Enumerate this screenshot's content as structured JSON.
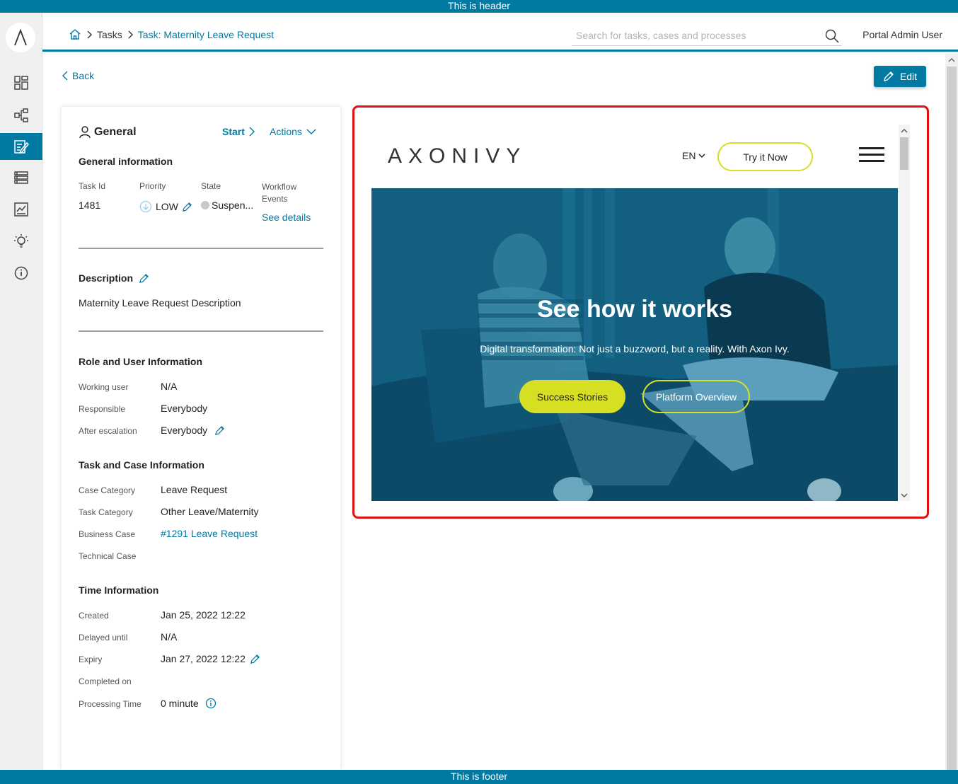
{
  "app": {
    "header_banner": "This is header",
    "footer_banner": "This is footer"
  },
  "header": {
    "breadcrumb": {
      "tasks": "Tasks",
      "current": "Task: Maternity Leave Request"
    },
    "search_placeholder": "Search for tasks, cases and processes",
    "user": "Portal Admin User"
  },
  "sidebar": {
    "items": [
      "dashboard-icon",
      "processes-icon",
      "tasks-icon",
      "cases-icon",
      "statistics-icon",
      "ideas-icon",
      "info-icon"
    ],
    "active": "tasks-icon"
  },
  "toolbar": {
    "back": "Back",
    "edit": "Edit"
  },
  "general": {
    "title": "General",
    "start": "Start",
    "actions": "Actions",
    "info_heading": "General information",
    "task_id_label": "Task Id",
    "task_id": "1481",
    "priority_label": "Priority",
    "priority": "LOW",
    "state_label": "State",
    "state": "Suspen...",
    "workflow_label": "Workflow Events",
    "see_details": "See details",
    "description_heading": "Description",
    "description": "Maternity Leave Request Description",
    "role_heading": "Role and User Information",
    "working_user_label": "Working user",
    "working_user": "N/A",
    "responsible_label": "Responsible",
    "responsible": "Everybody",
    "after_escalation_label": "After escalation",
    "after_escalation": "Everybody",
    "task_case_heading": "Task and Case Information",
    "case_category_label": "Case Category",
    "case_category": "Leave Request",
    "task_category_label": "Task Category",
    "task_category": "Other Leave/Maternity",
    "business_case_label": "Business Case",
    "business_case": "#1291 Leave Request",
    "technical_case_label": "Technical Case",
    "time_heading": "Time Information",
    "created_label": "Created",
    "created": "Jan 25, 2022 12:22",
    "delayed_label": "Delayed until",
    "delayed": "N/A",
    "expiry_label": "Expiry",
    "expiry": "Jan 27, 2022 12:22",
    "completed_label": "Completed on",
    "processing_label": "Processing Time",
    "processing": "0 minute"
  },
  "embedded": {
    "logo": "AXONIVY",
    "lang": "EN",
    "try_now": "Try it Now",
    "hero_title": "See how it works",
    "hero_subtitle": "Digital transformation: Not just a buzzword, but a reality. With Axon Ivy.",
    "success_stories": "Success Stories",
    "platform_overview": "Platform Overview"
  },
  "colors": {
    "brand": "#017aa3",
    "accent": "#d7df23",
    "highlight_border": "#e01010"
  }
}
